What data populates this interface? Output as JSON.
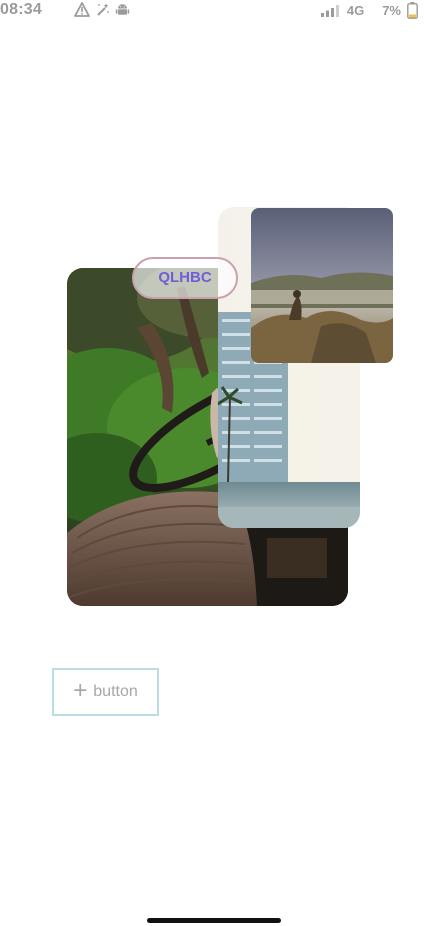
{
  "status_bar": {
    "time": "08:34",
    "left_icons": [
      "warning-icon",
      "magic-wand-icon",
      "android-icon"
    ],
    "signal_icon": "signal-icon",
    "network": "4G",
    "battery_percent": "7%",
    "battery_icon": "battery-icon"
  },
  "collage": {
    "badge_text": "QLHBC",
    "images": [
      "vintage-car-steering-wheel-photo",
      "tall-building-photo",
      "mountain-landscape-photo"
    ]
  },
  "add_button": {
    "label": "button",
    "icon": "plus-icon"
  },
  "colors": {
    "status_text": "#9b9b9b",
    "badge_border": "#c9a2ad",
    "badge_text": "#6d5fd6",
    "button_border": "#b8dde2",
    "button_text": "#a7a7a7",
    "battery_fill": "#f5c23c",
    "home_indicator": "#111111"
  }
}
